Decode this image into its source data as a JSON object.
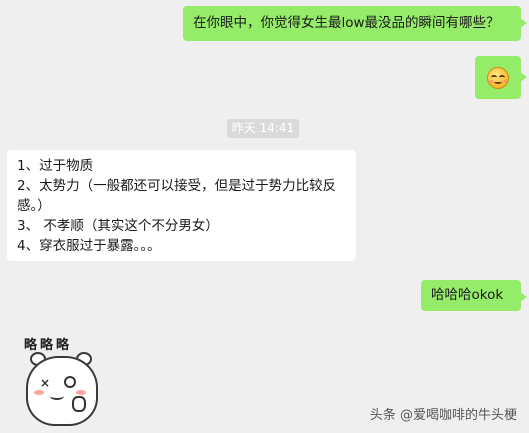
{
  "messages": {
    "question": "在你眼中，你觉得女生最low最没品的瞬间有哪些？",
    "emoji": "smiling-blush-face-icon",
    "timestamp": "昨天 14:41",
    "answer_lines": [
      "1、过于物质",
      "2、太势力（一般都还可以接受，但是过于势力比较反",
      "感。）",
      "3、 不孝顺（其实这个不分男女）",
      "4、穿衣服过于暴露。。。"
    ],
    "laugh": "哈哈哈okok",
    "sticker_text": "略略略"
  },
  "watermark": "头条 @爱喝咖啡的牛头梗",
  "colors": {
    "background": "#efefef",
    "outgoing_bubble": "#95ec69",
    "incoming_bubble": "#ffffff",
    "timestamp_bg": "#dadada"
  }
}
